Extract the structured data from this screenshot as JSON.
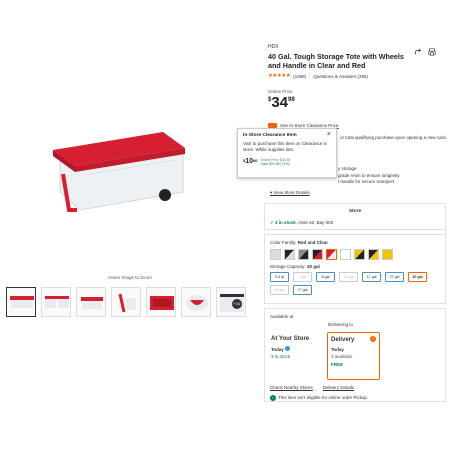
{
  "gallery": {
    "hover_text": "Hover Image to Zoom",
    "more_count": "+10"
  },
  "product": {
    "brand": "HDX",
    "title": "40 Gal. Tough Storage Tote with Wheels and Handle in Clear and Red",
    "stars": "★★★★★",
    "review_count": "(1069)",
    "qa": "Questions & Answers (295)",
    "online_price_label": "Online Price",
    "currency": "$",
    "price_dollars": "34",
    "price_cents": "98",
    "clearance_link": "See In-Store Clearance Price",
    "coupon_text": "ur total qualifying purchase upon opening a new card.",
    "details": [
      "y storage",
      "grade resin to ensure longevity",
      "t handle for secure transport"
    ],
    "view_more": "View More Details"
  },
  "tooltip": {
    "title": "In-Store Clearance Item",
    "close": "×",
    "body": "Visit                 to purchase this item on Clearance in store. While supplies last.",
    "price_sup": "$",
    "price": "10",
    "price_cents": "00",
    "was": "Online Price $34.98",
    "save": "Save $24.98 (71%)"
  },
  "store": {
    "label": "Store",
    "stock_check": "✓",
    "stock_count": "3 in stock",
    "aisle": "Aisle 62, Bay 002"
  },
  "options": {
    "color_label": "Color Family:",
    "color_value": "Red and Clear",
    "capacity_label": "Storage Capacity:",
    "capacity_value": "40 gal",
    "capacities": [
      "5.5 qt",
      "7 gal",
      "8 gal",
      "12 gal",
      "17 gal",
      "27 gal",
      "40 gal",
      "55 gal",
      "77 gal"
    ]
  },
  "availability": {
    "label": "Available at",
    "delivering_to": "Delivering to",
    "store_title": "At Your Store",
    "store_when": "Today",
    "store_stock": "3 in stock",
    "delivery_title": "Delivery",
    "delivery_when": "Today",
    "delivery_stock": "3 available",
    "delivery_free": "FREE",
    "check_link": "Check Nearby Stores",
    "details_link": "Delivery Details",
    "not_eligible": "This item isn't eligible for online order Pickup."
  },
  "colors": {
    "brand_orange": "#f96302",
    "tote_red": "#d6202f",
    "in_stock_green": "#00814a",
    "link_blue": "#4a90c2"
  }
}
